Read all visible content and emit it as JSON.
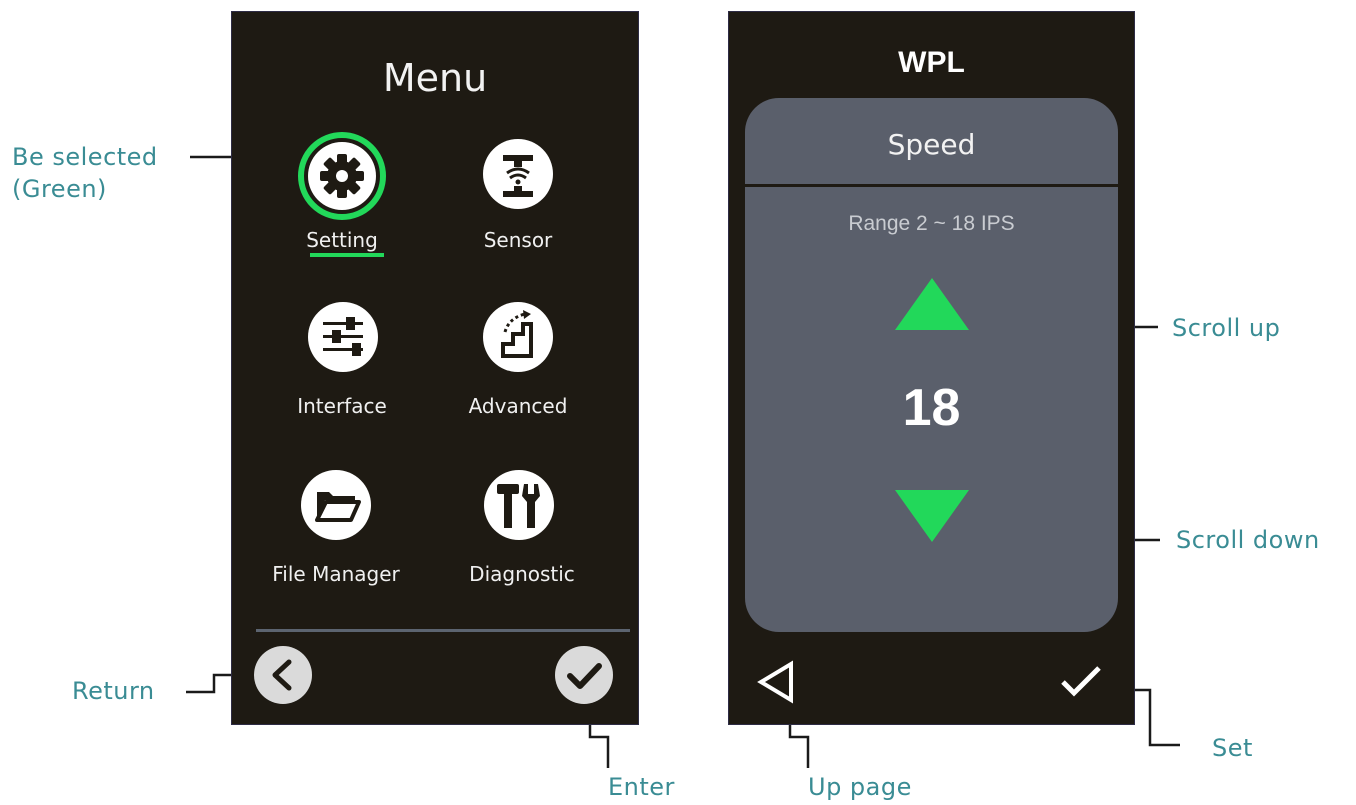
{
  "menu_screen": {
    "title": "Menu",
    "items": [
      {
        "label": "Setting",
        "icon": "gear-icon",
        "selected": true
      },
      {
        "label": "Sensor",
        "icon": "sensor-icon",
        "selected": false
      },
      {
        "label": "Interface",
        "icon": "sliders-icon",
        "selected": false
      },
      {
        "label": "Advanced",
        "icon": "stairs-icon",
        "selected": false
      },
      {
        "label": "File Manager",
        "icon": "folder-icon",
        "selected": false
      },
      {
        "label": "Diagnostic",
        "icon": "tools-icon",
        "selected": false
      }
    ],
    "return_icon": "chevron-left-icon",
    "enter_icon": "check-circle-icon"
  },
  "speed_screen": {
    "title": "WPL",
    "panel_title": "Speed",
    "range": "Range 2 ~ 18 IPS",
    "value": "18",
    "up_icon": "triangle-up-icon",
    "down_icon": "triangle-down-icon",
    "back_icon": "triangle-left-outline-icon",
    "set_icon": "checkmark-icon"
  },
  "annotations": {
    "be_selected_line1": "Be selected",
    "be_selected_line2": "(Green)",
    "return": "Return",
    "enter": "Enter",
    "scroll_up": "Scroll up",
    "scroll_down": "Scroll down",
    "up_page": "Up page",
    "set": "Set"
  },
  "colors": {
    "screen_bg": "#1e1a13",
    "selected_green": "#22d85a",
    "panel_gray": "#5a5f6b",
    "annotation_teal": "#3a8c94"
  }
}
